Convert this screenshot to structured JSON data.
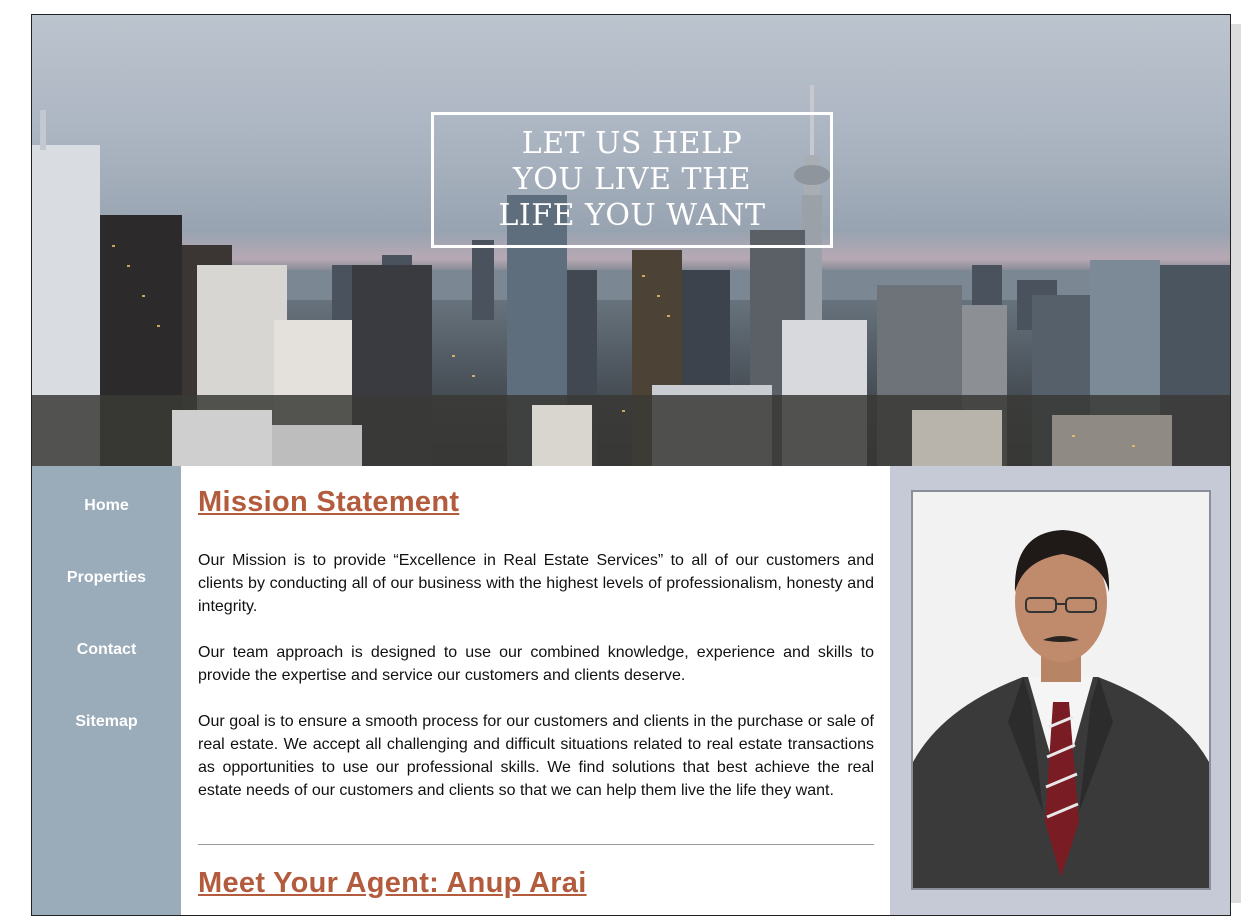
{
  "hero": {
    "title": "LET US HELP YOU LIVE THE LIFE YOU WANT"
  },
  "nav": {
    "items": [
      {
        "label": "Home"
      },
      {
        "label": "Properties"
      },
      {
        "label": "Contact"
      },
      {
        "label": "Sitemap"
      }
    ]
  },
  "main": {
    "mission_heading": "Mission Statement",
    "paragraphs": [
      "Our Mission is to provide “Excellence in Real Estate Services” to all of our customers and clients by conducting all of our business with the highest levels of professionalism, honesty and integrity.",
      "Our team approach is designed to use our combined knowledge, experience and skills to provide the expertise and service our customers and clients deserve.",
      "Our goal is to ensure a smooth process for our customers and clients in the purchase or sale of real estate. We accept all challenging and difficult situations related to real estate transactions as opportunities to use our professional skills. We find solutions that best achieve the real estate needs of our customers and clients so that we can help them live the life they want."
    ],
    "agent_heading": "Meet Your Agent: Anup Arai"
  },
  "colors": {
    "sidebar": "#9aabba",
    "heading": "#b35c3d",
    "right_panel": "#c5cad6"
  }
}
